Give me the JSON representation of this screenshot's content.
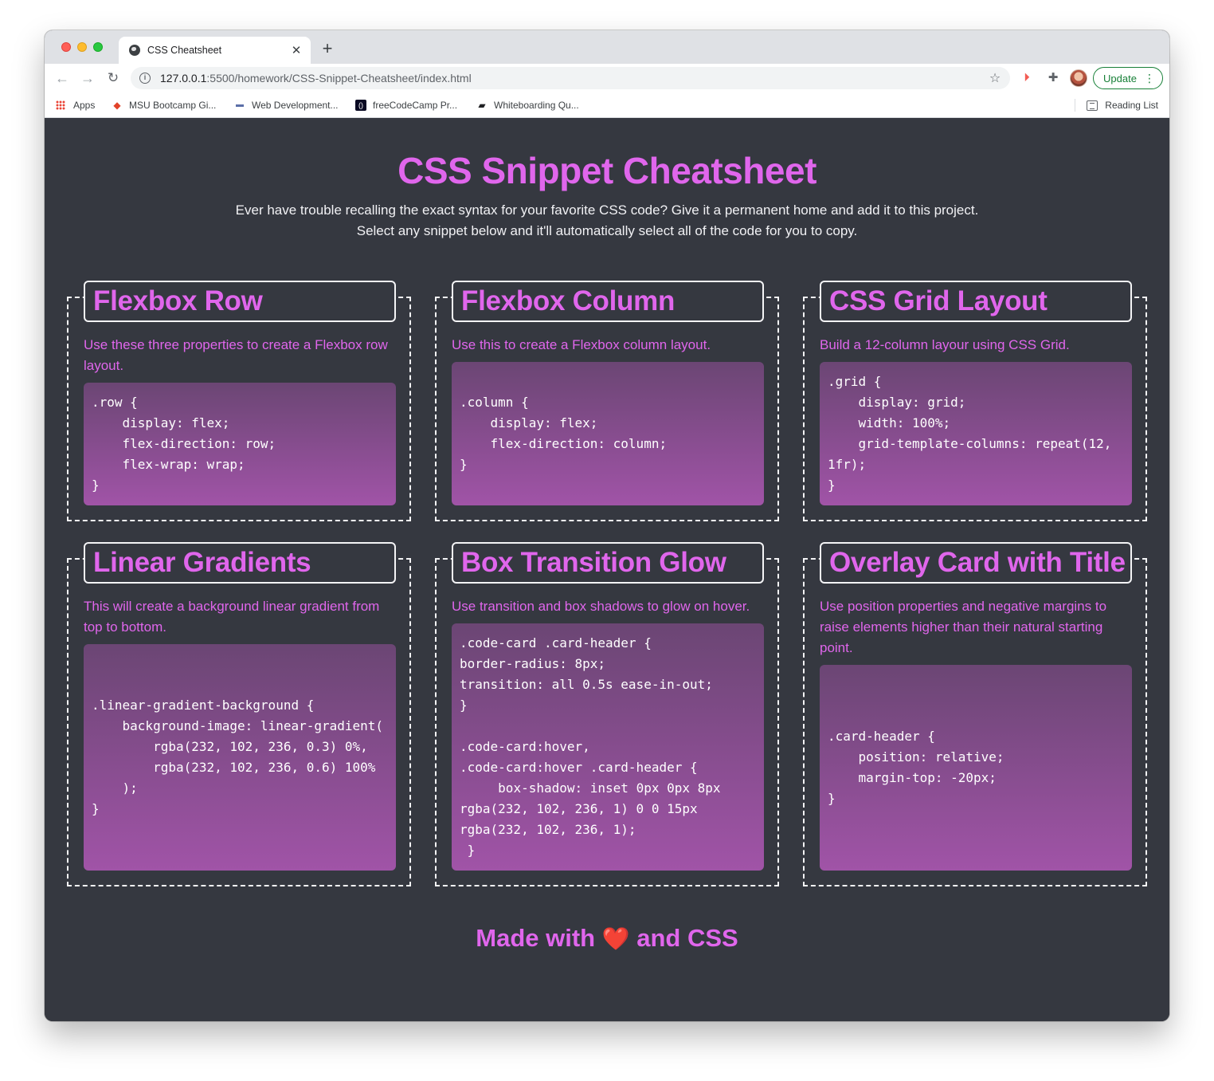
{
  "browser": {
    "tab_title": "CSS Cheatsheet",
    "tab_close": "✕",
    "new_tab": "+",
    "url_host": "127.0.0.1",
    "url_path": ":5500/homework/CSS-Snippet-Cheatsheet/index.html",
    "update_label": "Update",
    "bookmarks": [
      "Apps",
      "MSU Bootcamp Gi...",
      "Web Development...",
      "freeCodeCamp Pr...",
      "Whiteboarding Qu..."
    ],
    "reading_list": "Reading List"
  },
  "page": {
    "title": "CSS Snippet Cheatsheet",
    "intro_line1": "Ever have trouble recalling the exact syntax for your favorite CSS code? Give it a permanent home and add it to this project.",
    "intro_line2": "Select any snippet below and it'll automatically select all of the code for you to copy.",
    "footer_before": "Made with",
    "footer_heart": "❤️",
    "footer_after": "and CSS"
  },
  "cards": [
    {
      "title": "Flexbox Row",
      "description": "Use these three properties to create a Flexbox row layout.",
      "code": ".row {\n    display: flex;\n    flex-direction: row;\n    flex-wrap: wrap;\n}"
    },
    {
      "title": "Flexbox Column",
      "description": "Use this to create a Flexbox column layout.",
      "code": ".column {\n    display: flex;\n    flex-direction: column;\n}"
    },
    {
      "title": "CSS Grid Layout",
      "description": "Build a 12-column layour using CSS Grid.",
      "code": ".grid {\n    display: grid;\n    width: 100%;\n    grid-template-columns: repeat(12, 1fr);\n}"
    },
    {
      "title": "Linear Gradients",
      "description": "This will create a background linear gradient from top to bottom.",
      "code": ".linear-gradient-background {\n    background-image: linear-gradient(\n        rgba(232, 102, 236, 0.3) 0%,\n        rgba(232, 102, 236, 0.6) 100%\n    );\n}"
    },
    {
      "title": "Box Transition Glow",
      "description": "Use transition and box shadows to glow on hover.",
      "code": ".code-card .card-header {\nborder-radius: 8px;\ntransition: all 0.5s ease-in-out;\n}\n\n.code-card:hover,\n.code-card:hover .card-header {\n     box-shadow: inset 0px 0px 8px\nrgba(232, 102, 236, 1) 0 0 15px\nrgba(232, 102, 236, 1);\n }"
    },
    {
      "title": "Overlay Card with Title",
      "description": "Use position properties and negative margins to raise elements higher than their natural starting point.",
      "code": ".card-header {\n    position: relative;\n    margin-top: -20px;\n}"
    }
  ],
  "colors": {
    "accent": "#e066ec",
    "page_background": "#353840",
    "border": "#f4f4f6"
  }
}
